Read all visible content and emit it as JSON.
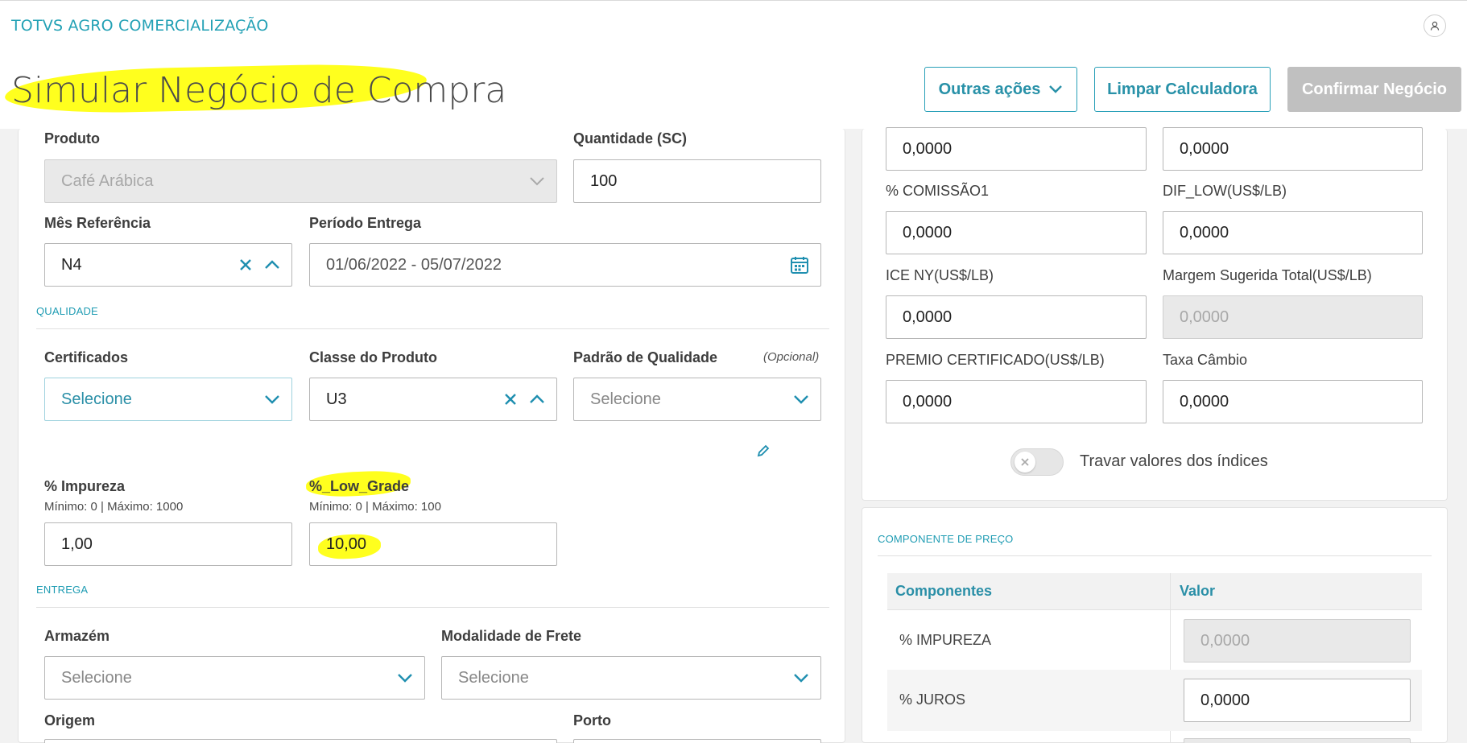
{
  "app": {
    "title": "TOTVS AGRO COMERCIALIZAÇÃO"
  },
  "header": {
    "page_title": "Simular Negócio de Compra",
    "actions": {
      "other_actions": "Outras ações",
      "clear_calculator": "Limpar Calculadora",
      "confirm_deal": "Confirmar Negócio"
    }
  },
  "form": {
    "produto": {
      "label": "Produto",
      "value": "Café Arábica"
    },
    "quantidade": {
      "label": "Quantidade (SC)",
      "value": "100"
    },
    "mes_referencia": {
      "label": "Mês Referência",
      "value": "N4"
    },
    "periodo_entrega": {
      "label": "Período Entrega",
      "value": "01/06/2022 - 05/07/2022"
    },
    "section_qualidade": "QUALIDADE",
    "certificados": {
      "label": "Certificados",
      "value": "Selecione"
    },
    "classe_produto": {
      "label": "Classe do Produto",
      "value": "U3"
    },
    "padrao_qualidade": {
      "label": "Padrão de Qualidade",
      "optional": "(Opcional)",
      "placeholder": "Selecione"
    },
    "impureza": {
      "label": "% Impureza",
      "hint": "Mínimo: 0 | Máximo: 1000",
      "value": "1,00"
    },
    "low_grade": {
      "label": "%_Low_Grade",
      "hint": "Mínimo: 0 | Máximo: 100",
      "value": "10,00"
    },
    "section_entrega": "ENTREGA",
    "armazem": {
      "label": "Armazém",
      "placeholder": "Selecione"
    },
    "modalidade_frete": {
      "label": "Modalidade de Frete",
      "placeholder": "Selecione"
    },
    "origem": {
      "label": "Origem"
    },
    "porto": {
      "label": "Porto"
    }
  },
  "indices": {
    "top_left": {
      "value": "0,0000"
    },
    "top_right": {
      "value": "0,0000"
    },
    "comissao1": {
      "label": "% COMISSÃO1",
      "value": "0,0000"
    },
    "dif_low": {
      "label": "DIF_LOW(US$/LB)",
      "value": "0,0000"
    },
    "ice_ny": {
      "label": "ICE NY(US$/LB)",
      "value": "0,0000"
    },
    "margem_sugerida": {
      "label": "Margem Sugerida Total(US$/LB)",
      "value": "0,0000"
    },
    "premio_certificado": {
      "label": "PREMIO CERTIFICADO(US$/LB)",
      "value": "0,0000"
    },
    "taxa_cambio": {
      "label": "Taxa Câmbio",
      "value": "0,0000"
    },
    "lock_toggle": {
      "label": "Travar valores dos índices",
      "on": false
    }
  },
  "price_components": {
    "section": "COMPONENTE DE PREÇO",
    "columns": [
      "Componentes",
      "Valor"
    ],
    "rows": [
      {
        "name": "% IMPUREZA",
        "value": "0,0000"
      },
      {
        "name": "% JUROS",
        "value": "0,0000"
      }
    ]
  },
  "colors": {
    "accent": "#23a1b5",
    "highlight": "#ffff1e",
    "disabled_button": "#c0c0c0"
  }
}
